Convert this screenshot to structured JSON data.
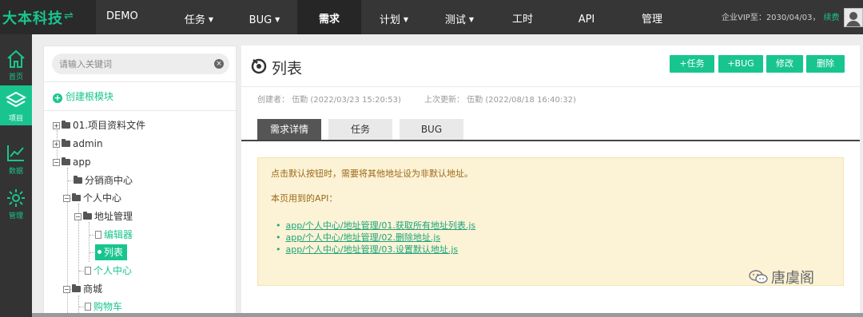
{
  "brand": {
    "name": "大本科技",
    "toggle_icon": "swap-icon"
  },
  "header": {
    "project": "DEMO",
    "nav": [
      {
        "label": "任务",
        "dropdown": true
      },
      {
        "label": "BUG",
        "dropdown": true
      },
      {
        "label": "需求",
        "dropdown": false,
        "active": true
      },
      {
        "label": "计划",
        "dropdown": true
      },
      {
        "label": "测试",
        "dropdown": true
      },
      {
        "label": "工时",
        "dropdown": false
      },
      {
        "label": "API",
        "dropdown": false
      },
      {
        "label": "管理",
        "dropdown": false
      }
    ],
    "vip_text": "企业VIP至：2030/04/03，",
    "renew_label": "续费"
  },
  "sidebar": {
    "items": [
      {
        "label": "首页",
        "icon": "home-icon"
      },
      {
        "label": "项目",
        "icon": "layers-icon",
        "active": true
      },
      {
        "label": "数据",
        "icon": "chart-icon"
      },
      {
        "label": "管理",
        "icon": "gear-icon"
      }
    ]
  },
  "tree": {
    "search_placeholder": "请输入关键词",
    "create_root": "创建根模块",
    "nodes": [
      {
        "label": "01.项目资料文件"
      },
      {
        "label": "admin"
      },
      {
        "label": "app"
      },
      {
        "label": "分销商中心"
      },
      {
        "label": "个人中心"
      },
      {
        "label": "地址管理"
      },
      {
        "label": "编辑器"
      },
      {
        "label": "列表"
      },
      {
        "label": "个人中心"
      },
      {
        "label": "商城"
      },
      {
        "label": "购物车"
      }
    ]
  },
  "main": {
    "title": "列表",
    "buttons": {
      "add_task": "+任务",
      "add_bug": "+BUG",
      "edit": "修改",
      "delete": "删除"
    },
    "creator": "创建者：  伍勤  (2022/03/23 15:20:53)",
    "updater": "上次更新：  伍勤  (2022/08/18 16:40:32)",
    "tabs": [
      {
        "label": "需求详情",
        "active": true
      },
      {
        "label": "任务"
      },
      {
        "label": "BUG"
      }
    ],
    "notice": {
      "line1": "点击默认按钮时，需要将其他地址设为非默认地址。",
      "line2": "本页用到的API：",
      "apis": [
        "app/个人中心/地址管理/01.获取所有地址列表.js",
        "app/个人中心/地址管理/02.删除地址.js",
        "app/个人中心/地址管理/03.设置默认地址.js"
      ]
    }
  },
  "watermark": "唐虞阁",
  "colors": {
    "accent": "#19c58f",
    "topbar": "#363636",
    "notice_bg": "#fcf2d6"
  }
}
